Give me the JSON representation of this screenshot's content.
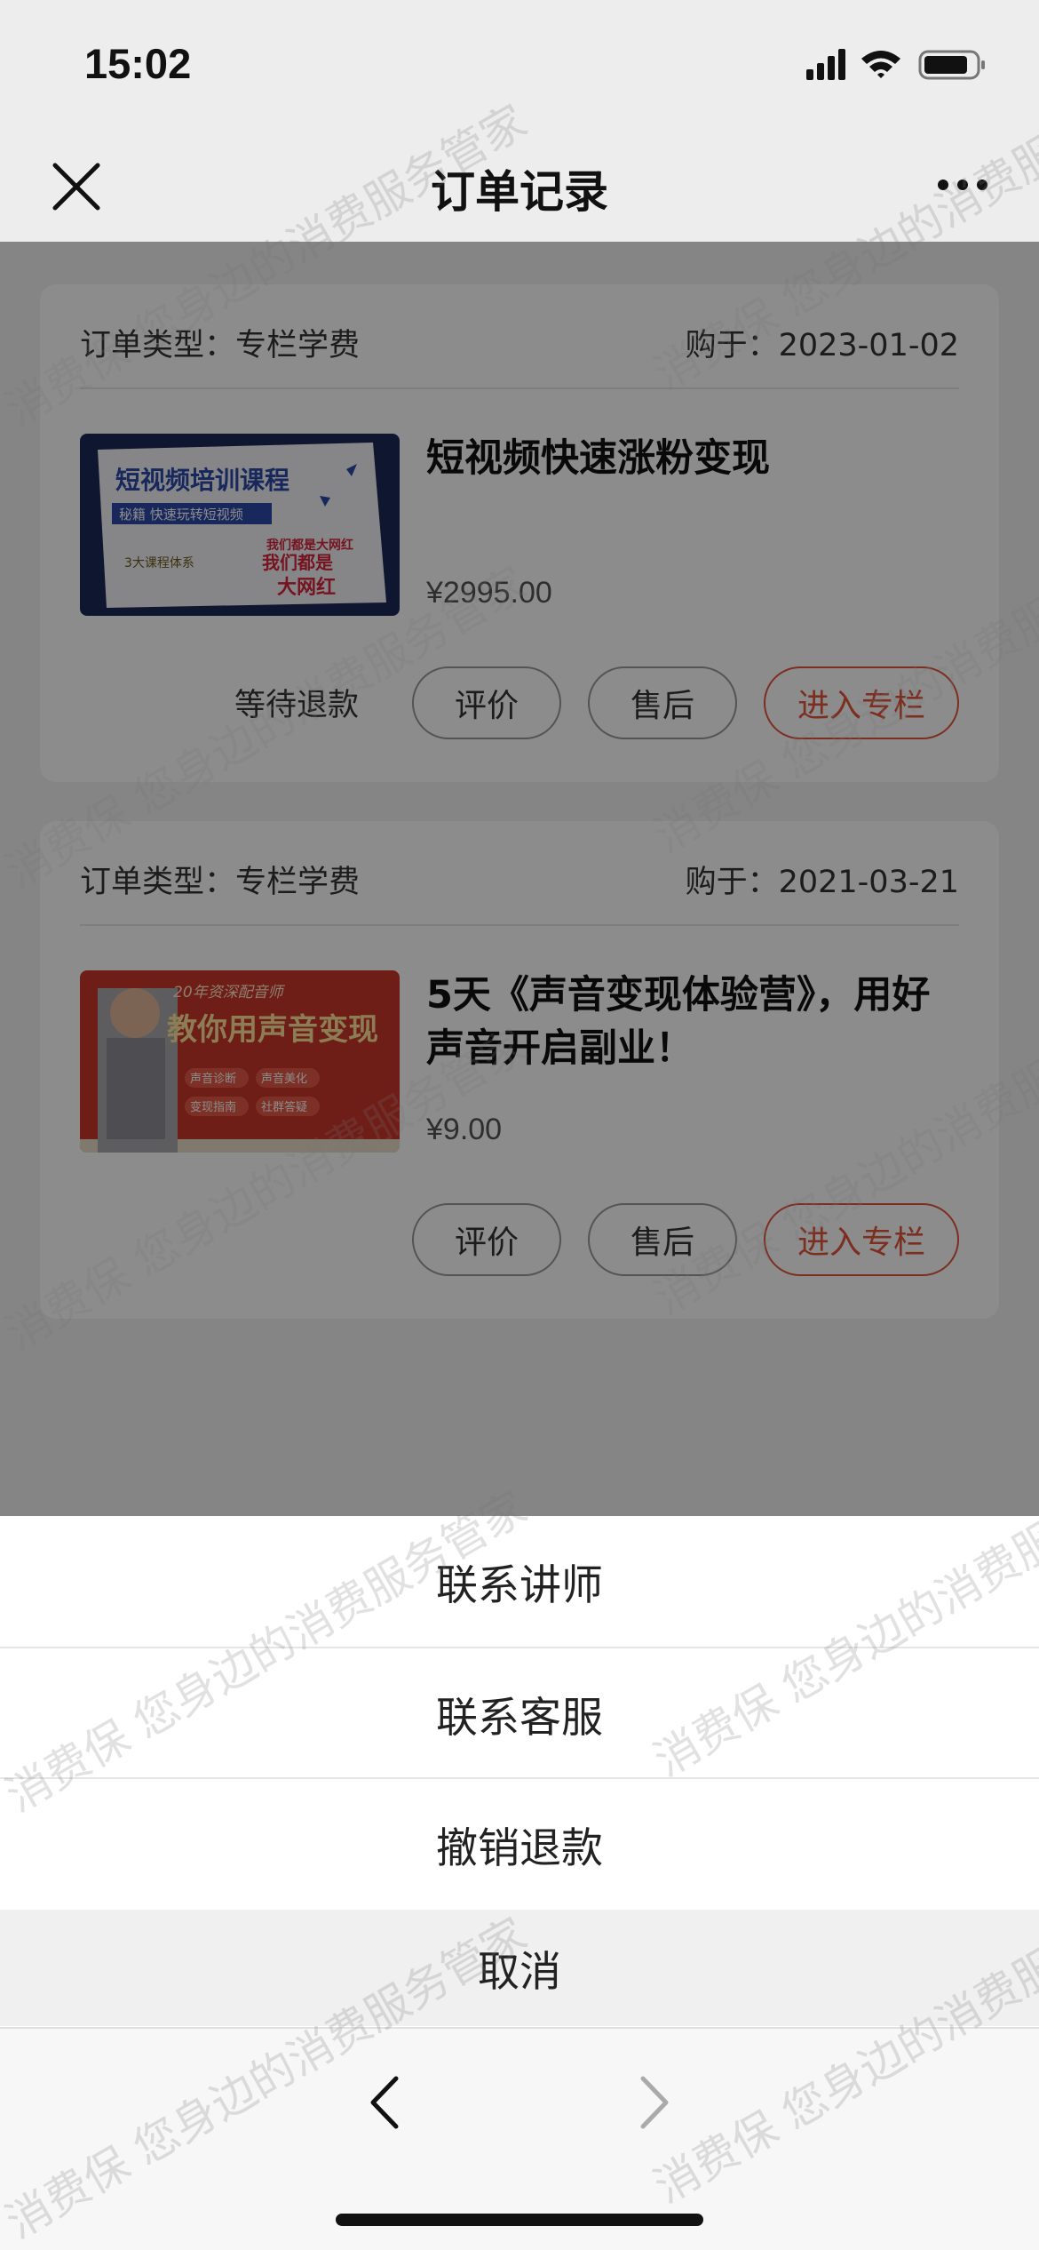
{
  "status_bar": {
    "time": "15:02"
  },
  "nav": {
    "title": "订单记录"
  },
  "orders": [
    {
      "type_label": "订单类型：专栏学费",
      "date_label": "购于：2023-01-02",
      "title": "短视频快速涨粉变现",
      "price": "¥2995.00",
      "status": "等待退款",
      "thumb": {
        "headline": "短视频培训课程",
        "subline": "秘籍 快速玩转短视频",
        "tag1": "我们都是大网红",
        "tag2": "我们都是",
        "tag3": "大网红",
        "footer": "3大课程体系"
      },
      "buttons": {
        "evaluate": "评价",
        "after_sale": "售后",
        "enter": "进入专栏"
      }
    },
    {
      "type_label": "订单类型：专栏学费",
      "date_label": "购于：2021-03-21",
      "title": "5天《声音变现体验营》，用好声音开启副业！",
      "price": "¥9.00",
      "status": "",
      "thumb": {
        "top": "20年资深配音师",
        "headline": "教你用声音变现",
        "chip1": "声音诊断",
        "chip2": "声音美化",
        "chip3": "变现指南",
        "chip4": "社群答疑"
      },
      "buttons": {
        "evaluate": "评价",
        "after_sale": "售后",
        "enter": "进入专栏"
      }
    }
  ],
  "action_sheet": {
    "items": [
      "联系讲师",
      "联系客服",
      "撤销退款"
    ],
    "cancel": "取消"
  },
  "watermark": {
    "text1": "消费保 您身边的消费服务管家"
  },
  "colors": {
    "accent": "#e2553c",
    "nav_bg": "#ededed"
  }
}
